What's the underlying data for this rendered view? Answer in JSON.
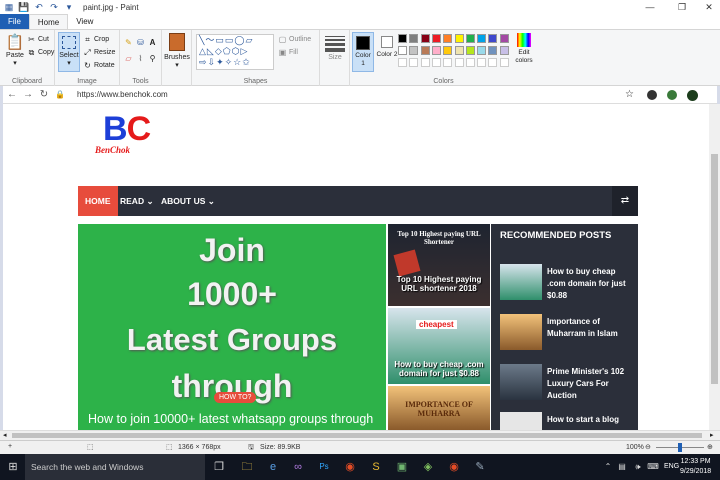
{
  "window": {
    "title": "paint.jpg - Paint"
  },
  "ribbon_tabs": [
    "File",
    "Home",
    "View"
  ],
  "clipboard": {
    "paste": "Paste",
    "cut": "Cut",
    "copy": "Copy",
    "group": "Clipboard"
  },
  "image": {
    "select": "Select",
    "crop": "Crop",
    "resize": "Resize",
    "rotate": "Rotate",
    "group": "Image"
  },
  "tools": {
    "group": "Tools"
  },
  "brushes": {
    "label": "Brushes"
  },
  "shapes": {
    "outline": "Outline",
    "fill": "Fill",
    "group": "Shapes"
  },
  "size": {
    "label": "Size"
  },
  "colors": {
    "color1": "Color 1",
    "color2": "Color 2",
    "edit": "Edit colors",
    "group": "Colors",
    "palette": [
      "#000000",
      "#7f7f7f",
      "#880015",
      "#ed1c24",
      "#ff7f27",
      "#fff200",
      "#22b14c",
      "#00a2e8",
      "#3f48cc",
      "#a349a4",
      "#ffffff",
      "#c3c3c3",
      "#b97a57",
      "#ffaec9",
      "#ffc90e",
      "#efe4b0",
      "#b5e61d",
      "#99d9ea",
      "#7092be",
      "#c8bfe7"
    ]
  },
  "browser": {
    "url": "https://www.benchok.com"
  },
  "site": {
    "logo_b": "B",
    "logo_c": "C",
    "logo_sub": "BenChok",
    "nav": {
      "home": "HOME",
      "read": "READ ⌄",
      "about": "ABOUT US ⌄"
    },
    "hero": {
      "lines": [
        "Join",
        "1000+",
        "Latest Groups",
        "through"
      ],
      "badge": "HOW TO?",
      "title": "How to join 10000+ latest whatsapp groups through"
    },
    "middle": [
      {
        "thumb_text": "Top 10 Highest paying URL Shortener",
        "title": "Top 10 Highest paying URL shortener 2018"
      },
      {
        "thumb_text": "cheapest",
        "title": "How to buy cheap .com domain for just $0.88"
      },
      {
        "thumb_text": "IMPORTANCE OF MUHARRA",
        "title": ""
      }
    ],
    "sidebar": {
      "heading": "RECOMMENDED POSTS",
      "posts": [
        {
          "title": "How to buy cheap .com domain for just $0.88"
        },
        {
          "title": "Importance of Muharram in Islam"
        },
        {
          "title": "Prime Minister's 102 Luxury Cars For Auction"
        },
        {
          "title": "How to start a blog"
        }
      ]
    }
  },
  "status": {
    "dimensions": "1366 × 768px",
    "size": "Size: 89.9KB",
    "zoom": "100%"
  },
  "taskbar": {
    "search": "Search the web and Windows",
    "time": "12:33 PM",
    "date": "9/29/2018",
    "lang": "ENG"
  }
}
